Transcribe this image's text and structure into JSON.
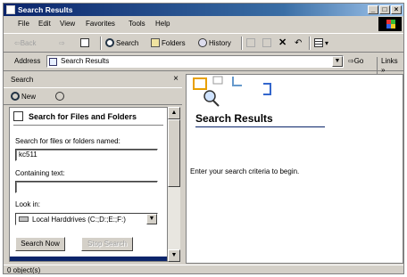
{
  "window": {
    "title": "Search Results",
    "minimize": "_",
    "maximize": "□",
    "close": "×"
  },
  "menu": [
    "File",
    "Edit",
    "View",
    "Favorites",
    "Tools",
    "Help"
  ],
  "toolbar": {
    "back": "⇦Back",
    "forward": "⇨",
    "search": "Search",
    "folders": "Folders",
    "history": "History",
    "delete": "✕",
    "undo": "↶",
    "views": "▾"
  },
  "address": {
    "label": "Address",
    "value": "Search Results",
    "go": "Go",
    "links": "Links »"
  },
  "search_pane": {
    "header": "Search",
    "close": "×",
    "new": "New",
    "title": "Search for Files and Folders",
    "named_label": "Search for files or folders named:",
    "named_value": "kc511",
    "containing_label": "Containing text:",
    "containing_value": "",
    "lookin_label": "Look in:",
    "lookin_value": "Local Harddrives (C:;D:;E:;F:)",
    "search_now": "Search Now",
    "stop_search": "Stop Search"
  },
  "results": {
    "heading": "Search Results",
    "message": "Enter your search criteria to begin."
  },
  "status": {
    "text": "0 object(s)"
  },
  "colors": {
    "title_bar": "#0a246a",
    "face": "#d4d0c8",
    "accent": "#0a246a"
  }
}
